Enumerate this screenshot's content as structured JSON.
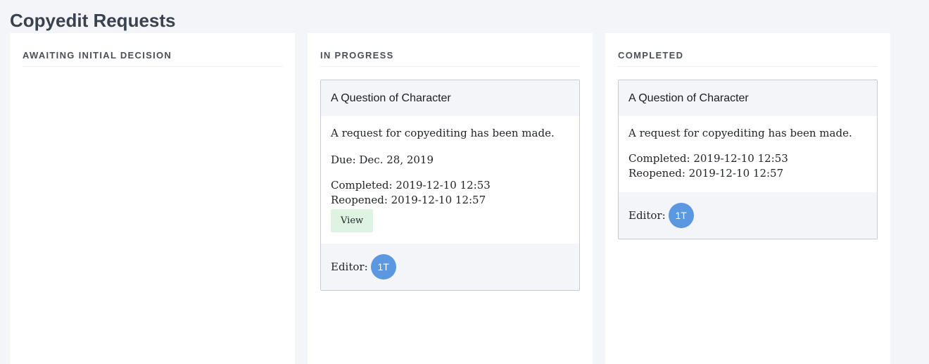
{
  "page": {
    "title": "Copyedit Requests"
  },
  "columns": [
    {
      "header": "AWAITING INITIAL DECISION"
    },
    {
      "header": "IN PROGRESS",
      "card": {
        "title": "A Question of Character",
        "message": "A request for copyediting has been made.",
        "due": "Due: Dec. 28, 2019",
        "completed": "Completed: 2019-12-10 12:53",
        "reopened": "Reopened: 2019-12-10 12:57",
        "view_label": "View",
        "editor_label": "Editor:",
        "editor_initials": "1T"
      }
    },
    {
      "header": "COMPLETED",
      "card": {
        "title": "A Question of Character",
        "message": "A request for copyediting has been made.",
        "completed": "Completed: 2019-12-10 12:53",
        "reopened": "Reopened: 2019-12-10 12:57",
        "editor_label": "Editor:",
        "editor_initials": "1T"
      }
    }
  ],
  "colors": {
    "page_background": "#f4f5f9",
    "view_button": "#dff3e2",
    "avatar": "#5b98e0"
  }
}
